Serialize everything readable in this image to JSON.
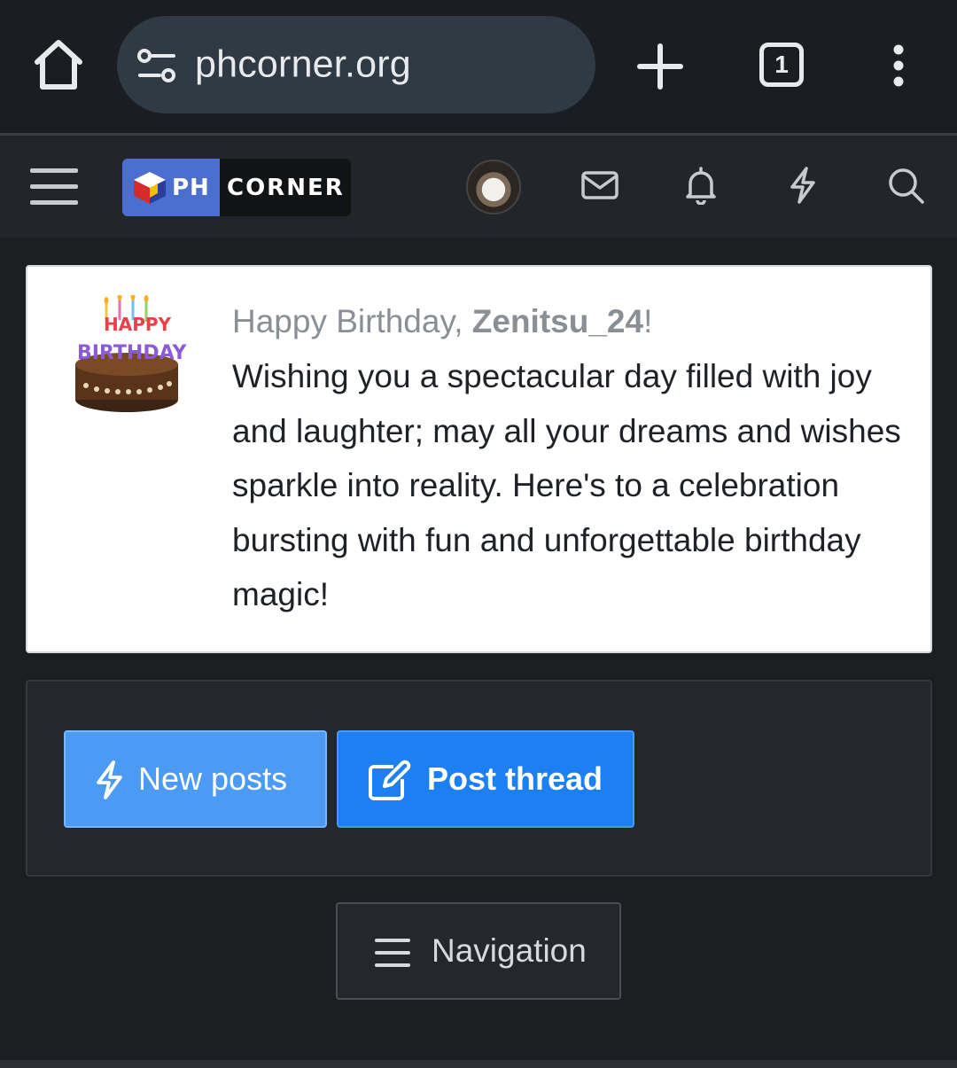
{
  "browser": {
    "url": "phcorner.org",
    "tab_count": "1"
  },
  "site": {
    "logo_left": "PH",
    "logo_right": "CORNER"
  },
  "notice": {
    "greeting_prefix": "Happy Birthday, ",
    "username": "Zenitsu_24",
    "greeting_suffix": "!",
    "message": "Wishing you a spectacular day filled with joy and laughter; may all your dreams and wishes sparkle into reality. Here's to a celebration bursting with fun and unforgettable birthday magic!",
    "cake_text_line1": "HAPPY",
    "cake_text_line2": "BIRTHDAY"
  },
  "actions": {
    "new_posts_label": "New posts",
    "post_thread_label": "Post thread"
  },
  "navigation": {
    "label": "Navigation"
  },
  "colors": {
    "accent_blue": "#1c7ff2",
    "secondary_blue": "#4b9bf5",
    "logo_blue": "#4a6fd1"
  }
}
